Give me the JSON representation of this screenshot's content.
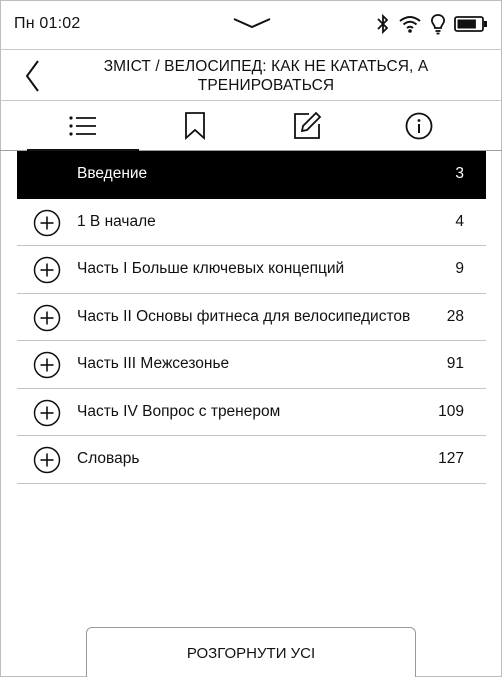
{
  "status_bar": {
    "time": "Пн 01:02",
    "icons": [
      "pull-down-icon",
      "bluetooth-icon",
      "wifi-icon",
      "frontlight-icon",
      "battery-icon"
    ],
    "battery_level": 0.8
  },
  "header": {
    "title": "ЗМІСТ / ВЕЛОСИПЕД: КАК НЕ КАТАТЬСЯ, А ТРЕНИРОВАТЬСЯ"
  },
  "tabs": [
    {
      "icon": "list-icon",
      "active": true
    },
    {
      "icon": "bookmark-icon",
      "active": false
    },
    {
      "icon": "note-icon",
      "active": false
    },
    {
      "icon": "info-icon",
      "active": false
    }
  ],
  "toc": {
    "items": [
      {
        "label": "Введение",
        "page": "3",
        "current": true,
        "expandable": false
      },
      {
        "label": "1 В начале",
        "page": "4",
        "current": false,
        "expandable": true
      },
      {
        "label": "Часть I Больше ключевых концепций",
        "page": "9",
        "current": false,
        "expandable": true
      },
      {
        "label": "Часть II Основы фитнеса для велосипедистов",
        "page": "28",
        "current": false,
        "expandable": true
      },
      {
        "label": "Часть III Межсезонье",
        "page": "91",
        "current": false,
        "expandable": true
      },
      {
        "label": "Часть IV Вопрос с тренером",
        "page": "109",
        "current": false,
        "expandable": true
      },
      {
        "label": "Словарь",
        "page": "127",
        "current": false,
        "expandable": true
      }
    ]
  },
  "footer": {
    "expand_all_label": "РОЗГОРНУТИ УСІ"
  }
}
